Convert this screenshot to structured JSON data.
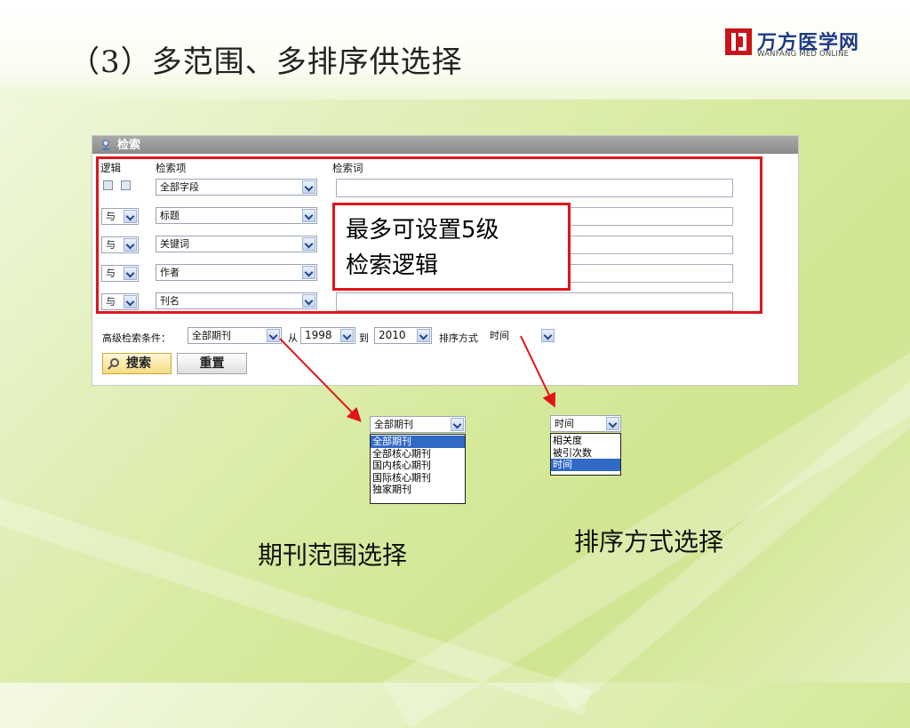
{
  "slide": {
    "title": "（3）多范围、多排序供选择",
    "logo": {
      "cn": "万方医学网",
      "en": "WANFANG MED ONLINE"
    }
  },
  "panel": {
    "header": "检索",
    "col_logic": "逻辑",
    "col_field": "检索项",
    "col_term": "检索词",
    "rows": [
      {
        "logic": "",
        "field": "全部字段"
      },
      {
        "logic": "与",
        "field": "标题"
      },
      {
        "logic": "与",
        "field": "关键词"
      },
      {
        "logic": "与",
        "field": "作者"
      },
      {
        "logic": "与",
        "field": "刊名"
      }
    ],
    "adv_label": "高级检索条件：",
    "journal_scope": "全部期刊",
    "from_label": "从",
    "year_from": "1998",
    "to_label": "到",
    "year_to": "2010",
    "sort_label": "排序方式",
    "sort_value": "时间",
    "search_btn": "搜索",
    "reset_btn": "重置"
  },
  "callout": {
    "line1": "最多可设置5级",
    "line2": "检索逻辑"
  },
  "journal_dropdown": {
    "selected": "全部期刊",
    "options": [
      "全部期刊",
      "全部核心期刊",
      "国内核心期刊",
      "国际核心期刊",
      "独家期刊"
    ],
    "highlighted_index": 0
  },
  "sort_dropdown": {
    "selected": "时间",
    "options": [
      "相关度",
      "被引次数",
      "时间"
    ],
    "highlighted_index": 2
  },
  "captions": {
    "journal": "期刊范围选择",
    "sort": "排序方式选择"
  },
  "colors": {
    "accent_red": "#e0141a",
    "highlight_blue": "#3169c6",
    "logo_blue": "#1f3b85",
    "logo_red": "#c9141a"
  }
}
